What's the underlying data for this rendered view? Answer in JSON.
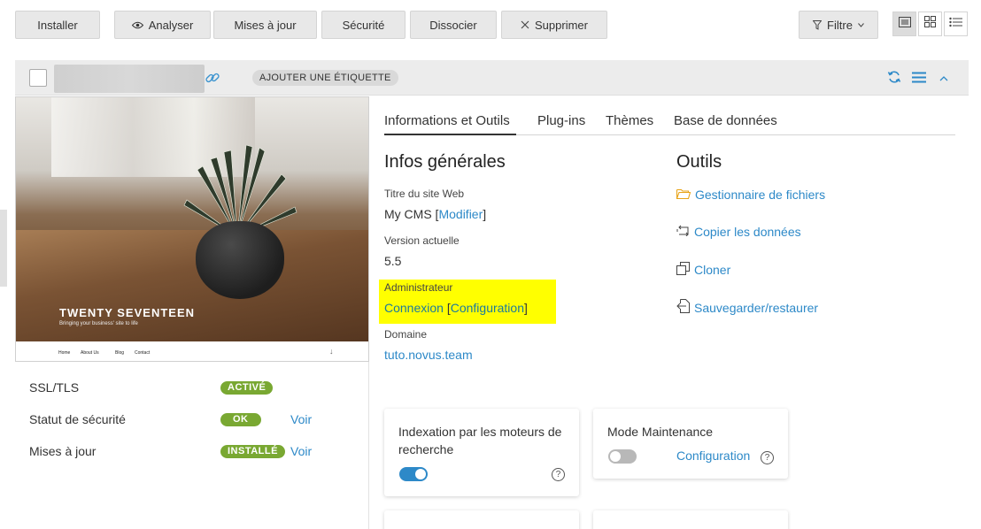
{
  "toolbar": {
    "install": "Installer",
    "analyze": "Analyser",
    "updates": "Mises à jour",
    "security": "Sécurité",
    "detach": "Dissocier",
    "delete": "Supprimer",
    "filter": "Filtre"
  },
  "card": {
    "add_tag": "AJOUTER UNE ÉTIQUETTE"
  },
  "preview": {
    "site_title": "TWENTY SEVENTEEN",
    "site_subtitle": "Bringing your business' site to life",
    "nav": [
      "Home",
      "About Us",
      "Blog",
      "Contact"
    ]
  },
  "status": [
    {
      "label": "SSL/TLS",
      "badge": "ACTIVÉ",
      "link": ""
    },
    {
      "label": "Statut de sécurité",
      "badge": "OK",
      "link": "Voir"
    },
    {
      "label": "Mises à jour",
      "badge": "INSTALLÉ",
      "link": "Voir"
    }
  ],
  "tabs": [
    "Informations et Outils",
    "Plug-ins",
    "Thèmes",
    "Base de données"
  ],
  "general": {
    "heading": "Infos générales",
    "site_title_label": "Titre du site Web",
    "site_title_value": "My CMS",
    "modify_link": "Modifier",
    "version_label": "Version actuelle",
    "version_value": "5.5",
    "admin_label": "Administrateur",
    "login_link": "Connexion",
    "config_link": "Configuration",
    "domain_label": "Domaine",
    "domain_value": "tuto.novus.team"
  },
  "tools": {
    "heading": "Outils",
    "items": [
      "Gestionnaire de fichiers",
      "Copier les données",
      "Cloner",
      "Sauvegarder/restaurer"
    ]
  },
  "tiles": {
    "indexing_title": "Indexation par les moteurs de recherche",
    "indexing_on": true,
    "maintenance_title": "Mode Maintenance",
    "maintenance_on": false,
    "maintenance_link": "Configuration"
  },
  "colors": {
    "accent": "#2d89c8",
    "badge_green": "#79a832",
    "highlight": "#ffff00",
    "folder_orange": "#e8a317"
  }
}
